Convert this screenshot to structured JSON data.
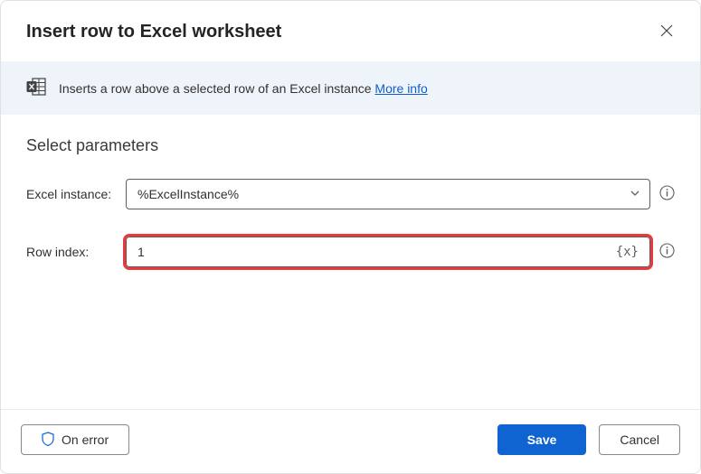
{
  "dialog": {
    "title": "Insert row to Excel worksheet"
  },
  "banner": {
    "text": "Inserts a row above a selected row of an Excel instance ",
    "linkText": "More info"
  },
  "section": {
    "title": "Select parameters"
  },
  "fields": {
    "excelInstance": {
      "label": "Excel instance:",
      "value": "%ExcelInstance%"
    },
    "rowIndex": {
      "label": "Row index:",
      "value": "1",
      "varToken": "{x}"
    }
  },
  "buttons": {
    "onError": "On error",
    "save": "Save",
    "cancel": "Cancel"
  }
}
